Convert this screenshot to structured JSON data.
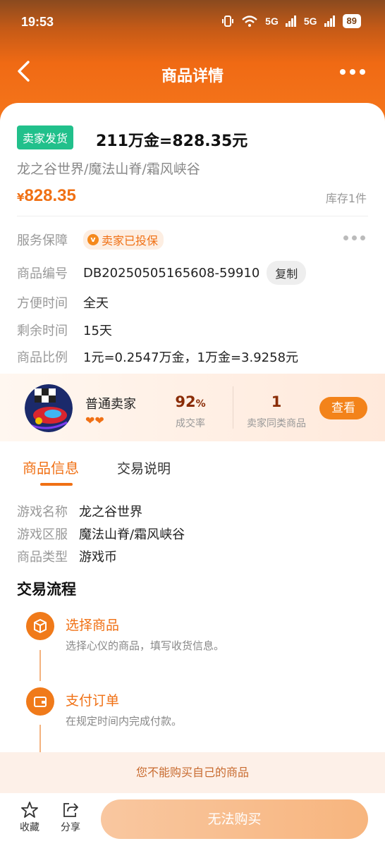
{
  "status_bar": {
    "time": "19:53",
    "network_1": "5G",
    "network_2": "5G",
    "battery": "89"
  },
  "nav": {
    "title": "商品详情"
  },
  "goods": {
    "seller_tag": "卖家发货",
    "title": "211万金=828.35元",
    "server": "龙之谷世界/魔法山脊/霜风峡谷",
    "currency": "¥",
    "price": "828.35",
    "stock": "库存1件"
  },
  "info": {
    "service_label": "服务保障",
    "insured": "卖家已投保",
    "insured_icon": "v",
    "code_label": "商品编号",
    "code_value": "DB20250505165608-59910",
    "copy_label": "复制",
    "time_label": "方便时间",
    "time_value": "全天",
    "remain_label": "剩余时间",
    "remain_value": "15天",
    "ratio_label": "商品比例",
    "ratio_value": "1元=0.2547万金，1万金=3.9258元"
  },
  "seller": {
    "name": "普通卖家",
    "hearts": "❤❤",
    "deal_rate": "92",
    "deal_rate_unit": "%",
    "deal_rate_label": "成交率",
    "same_goods": "1",
    "same_goods_label": "卖家同类商品",
    "view_label": "查看"
  },
  "tabs": [
    {
      "label": "商品信息",
      "active": true
    },
    {
      "label": "交易说明",
      "active": false
    }
  ],
  "details": [
    {
      "label": "游戏名称",
      "value": "龙之谷世界"
    },
    {
      "label": "游戏区服",
      "value": "魔法山脊/霜风峡谷"
    },
    {
      "label": "商品类型",
      "value": "游戏币"
    }
  ],
  "flow": {
    "title": "交易流程",
    "steps": [
      {
        "title": "选择商品",
        "desc": "选择心仪的商品，填写收货信息。",
        "icon": "box-icon"
      },
      {
        "title": "支付订单",
        "desc": "在规定时间内完成付款。",
        "icon": "wallet-icon"
      }
    ]
  },
  "notice": "您不能购买自己的商品",
  "bottom": {
    "favorite_label": "收藏",
    "share_label": "分享",
    "buy_label": "无法购买"
  },
  "colors": {
    "accent": "#f07014",
    "seller_tag": "#21c08b",
    "buy_disabled": "#f7b57e"
  }
}
